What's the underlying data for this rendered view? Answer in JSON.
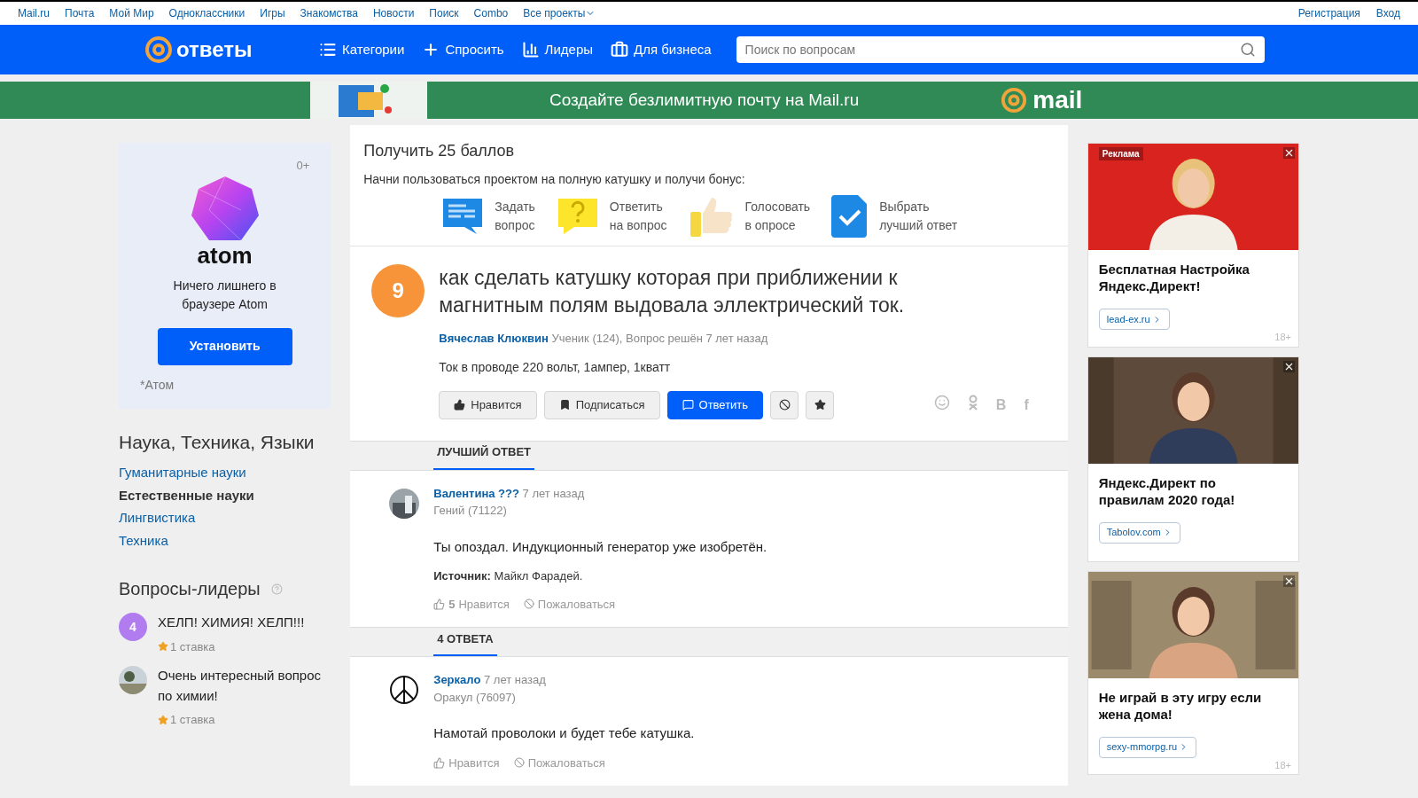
{
  "top_links": [
    {
      "label": "Mail.ru",
      "dropdown": false
    },
    {
      "label": "Почта",
      "dropdown": false
    },
    {
      "label": "Мой Мир",
      "dropdown": false
    },
    {
      "label": "Одноклассники",
      "dropdown": false
    },
    {
      "label": "Игры",
      "dropdown": false
    },
    {
      "label": "Знакомства",
      "dropdown": false
    },
    {
      "label": "Новости",
      "dropdown": false
    },
    {
      "label": "Поиск",
      "dropdown": false
    },
    {
      "label": "Combo",
      "dropdown": false
    },
    {
      "label": "Все проекты",
      "dropdown": true
    }
  ],
  "auth_links": [
    "Регистрация",
    "Вход"
  ],
  "header": {
    "logo_text": "ответы",
    "nav": [
      {
        "kind": "categories",
        "label": "Категории"
      },
      {
        "kind": "ask",
        "label": "Спросить"
      },
      {
        "kind": "leaders",
        "label": "Лидеры"
      },
      {
        "kind": "business",
        "label": "Для бизнеса"
      }
    ],
    "search": {
      "placeholder": "Поиск по вопросам"
    }
  },
  "banner": {
    "text": "Создайте безлимитную почту на Mail.ru",
    "logo_text": "mail"
  },
  "sidebar": {
    "ad": {
      "age": "0+",
      "brand": "atom",
      "text": "Ничего лишнего в браузере Atom",
      "button": "Установить",
      "note": "*Атом"
    },
    "category": {
      "title": "Наука, Техника, Языки",
      "items": [
        {
          "label": "Гуманитарные науки",
          "selected": false
        },
        {
          "label": "Естественные науки",
          "selected": true
        },
        {
          "label": "Лингвистика",
          "selected": false
        },
        {
          "label": "Техника",
          "selected": false
        }
      ]
    },
    "leaders": {
      "title": "Вопросы-лидеры",
      "items": [
        {
          "kind": "badge",
          "badge": "4",
          "title": "ХЕЛП! ХИМИЯ! ХЕЛП!!!",
          "stakes": "1 ставка"
        },
        {
          "kind": "avatar",
          "title": "Очень интересный вопрос по химии!",
          "stakes": "1 ставка"
        }
      ]
    }
  },
  "bonus": {
    "title": "Получить 25 баллов",
    "subtitle": "Начни пользоваться проектом на полную катушку и получи бонус:",
    "steps": [
      {
        "kind": "ask",
        "lines": [
          "Задать",
          "вопрос"
        ]
      },
      {
        "kind": "answer",
        "lines": [
          "Ответить",
          "на вопрос"
        ]
      },
      {
        "kind": "vote",
        "lines": [
          "Голосовать",
          "в опросе"
        ]
      },
      {
        "kind": "best",
        "lines": [
          "Выбрать",
          "лучший ответ"
        ]
      }
    ]
  },
  "question": {
    "score": "9",
    "title": "как сделать катушку которая при приближении к магнитным полям выдовала эллектрический ток.",
    "author": "Вячеслав Клюквин",
    "meta": "Ученик (124), Вопрос решён 7 лет назад",
    "body": "Ток в проводе 220 вольт, 1ампер, 1кватт",
    "actions": [
      {
        "kind": "like",
        "label": "Нравится"
      },
      {
        "kind": "subscribe",
        "label": "Подписаться"
      },
      {
        "kind": "answer",
        "label": "Ответить"
      },
      {
        "kind": "block"
      },
      {
        "kind": "star"
      }
    ],
    "share": [
      {
        "kind": "smile"
      },
      {
        "kind": "ok"
      },
      {
        "kind": "letter",
        "text": "В"
      },
      {
        "kind": "letter",
        "text": "f"
      }
    ]
  },
  "best_answer": {
    "tab": "ЛУЧШИЙ ОТВЕТ",
    "answer": {
      "kind": "picture",
      "author": "Валентина ???",
      "time": "7 лет назад",
      "rank": "Гений (71122)",
      "text": "Ты опоздал. Индукционный генератор уже изобретён.",
      "source_label": "Источник:",
      "source": "Майкл Фарадей.",
      "likes": "5",
      "like_label": "Нравится",
      "report": "Пожаловаться"
    }
  },
  "answers": {
    "tab": "4 ОТВЕТА",
    "items": [
      {
        "kind": "icon",
        "author": "Зеркало",
        "time": "7 лет назад",
        "rank": "Оракул (76097)",
        "text": "Намотай проволоки и будет тебе катушка.",
        "like_label": "Нравится",
        "report": "Пожаловаться"
      }
    ]
  },
  "ads": [
    {
      "badge": "Реклама",
      "kind": "picture",
      "title": "Бесплатная Настройка Яндекс.Директ!",
      "link": "lead-ex.ru",
      "age": "18+"
    },
    {
      "kind": "picture",
      "title": "Яндекс.Директ по правилам 2020 года!",
      "link": "Tabolov.com"
    },
    {
      "kind": "picture",
      "title": "Не играй в эту игру если жена дома!",
      "link": "sexy-mmorpg.ru",
      "age": "18+"
    }
  ]
}
